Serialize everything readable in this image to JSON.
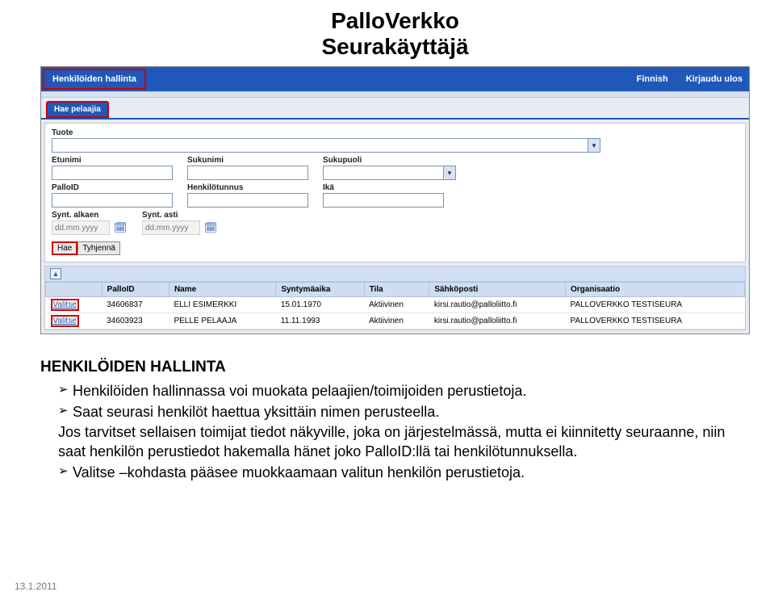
{
  "heading": {
    "line1": "PalloVerkko",
    "line2": "Seurakäyttäjä"
  },
  "topbar": {
    "main_tab": "Henkilöiden hallinta",
    "language": "Finnish",
    "logout": "Kirjaudu ulos"
  },
  "subtab": {
    "label": "Hae pelaajia"
  },
  "form": {
    "product_label": "Tuote",
    "etunimi_label": "Etunimi",
    "sukunimi_label": "Sukunimi",
    "sukupuoli_label": "Sukupuoli",
    "palloid_label": "PalloID",
    "henkilotunnus_label": "Henkilötunnus",
    "ika_label": "Ikä",
    "synt_alkaen_label": "Synt. alkaen",
    "synt_asti_label": "Synt. asti",
    "date_placeholder": "dd.mm.yyyy",
    "search_btn": "Hae",
    "clear_btn": "Tyhjennä"
  },
  "grid": {
    "collapse_glyph": "▲",
    "headers": [
      "",
      "PalloID",
      "Name",
      "Syntymäaika",
      "Tila",
      "Sähköposti",
      "Organisaatio"
    ],
    "select_label": "Valitse",
    "rows": [
      {
        "id": "34606837",
        "name": "ELLI ESIMERKKI",
        "dob": "15.01.1970",
        "status": "Aktiivinen",
        "email": "kirsi.rautio@palloliitto.fi",
        "org": "PALLOVERKKO TESTISEURA"
      },
      {
        "id": "34603923",
        "name": "PELLE PELAAJA",
        "dob": "11.11.1993",
        "status": "Aktiivinen",
        "email": "kirsi.rautio@palloliitto.fi",
        "org": "PALLOVERKKO TESTISEURA"
      }
    ]
  },
  "description": {
    "title": "HENKILÖIDEN HALLINTA",
    "b1": "Henkilöiden hallinnassa voi muokata pelaajien/toimijoiden perustietoja.",
    "b2": "Saat seurasi henkilöt haettua yksittäin nimen perusteella.",
    "b2_cont": "Jos tarvitset sellaisen toimijat tiedot näkyville, joka on järjestelmässä, mutta ei kiinnitetty seuraanne, niin saat henkilön perustiedot hakemalla hänet joko PalloID:llä tai henkilötunnuksella.",
    "b3": "Valitse –kohdasta pääsee muokkaamaan valitun henkilön perustietoja."
  },
  "footer_date": "13.1.2011"
}
